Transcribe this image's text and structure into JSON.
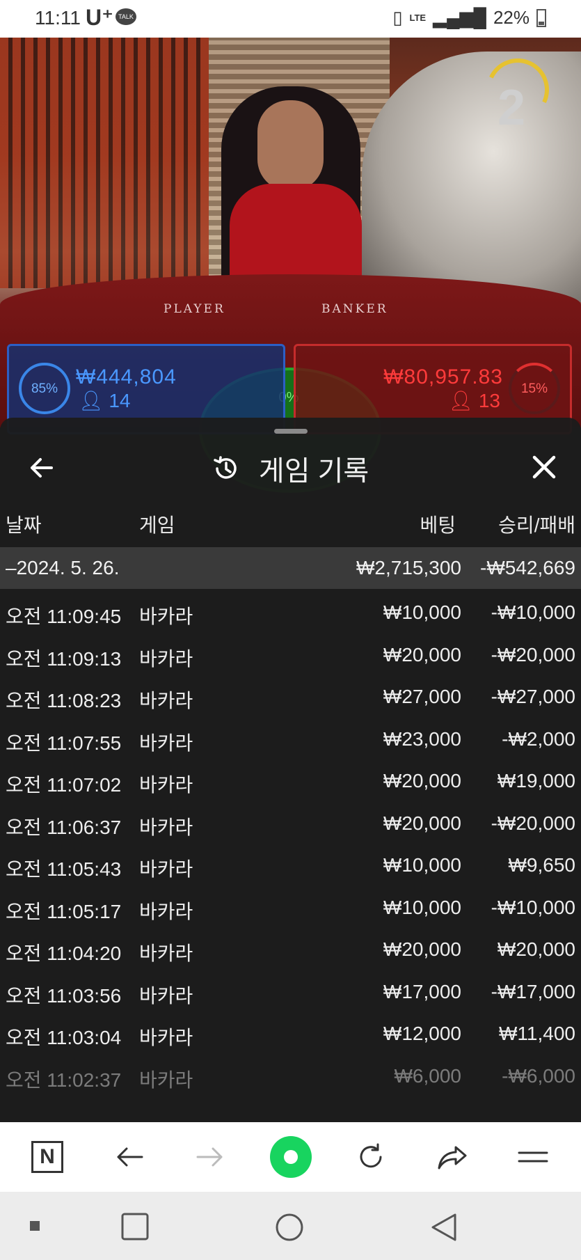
{
  "status_bar": {
    "time": "11:11",
    "carrier": "U⁺",
    "talk_badge": "TALK",
    "network": "LTE",
    "battery": "22%"
  },
  "video": {
    "timer_value": "2",
    "table_player_text": "PLAYER",
    "table_banker_text": "BANKER"
  },
  "bets": {
    "player": {
      "percent": "85%",
      "amount": "₩444,804",
      "count": "14"
    },
    "banker": {
      "percent": "15%",
      "amount": "₩80,957.83",
      "count": "13"
    },
    "tie": {
      "percent": "0%"
    }
  },
  "sheet": {
    "title": "게임 기록",
    "columns": {
      "date": "날짜",
      "game": "게임",
      "bet": "베팅",
      "result": "승리/패배"
    },
    "summary": {
      "date": "–2024. 5. 26.",
      "bet": "₩2,715,300",
      "result": "-₩542,669"
    },
    "rows": [
      {
        "time": "오전 11:09:45",
        "game": "바카라",
        "bet": "₩10,000",
        "result": "-₩10,000"
      },
      {
        "time": "오전 11:09:13",
        "game": "바카라",
        "bet": "₩20,000",
        "result": "-₩20,000"
      },
      {
        "time": "오전 11:08:23",
        "game": "바카라",
        "bet": "₩27,000",
        "result": "-₩27,000"
      },
      {
        "time": "오전 11:07:55",
        "game": "바카라",
        "bet": "₩23,000",
        "result": "-₩2,000"
      },
      {
        "time": "오전 11:07:02",
        "game": "바카라",
        "bet": "₩20,000",
        "result": "₩19,000"
      },
      {
        "time": "오전 11:06:37",
        "game": "바카라",
        "bet": "₩20,000",
        "result": "-₩20,000"
      },
      {
        "time": "오전 11:05:43",
        "game": "바카라",
        "bet": "₩10,000",
        "result": "₩9,650"
      },
      {
        "time": "오전 11:05:17",
        "game": "바카라",
        "bet": "₩10,000",
        "result": "-₩10,000"
      },
      {
        "time": "오전 11:04:20",
        "game": "바카라",
        "bet": "₩20,000",
        "result": "₩20,000"
      },
      {
        "time": "오전 11:03:56",
        "game": "바카라",
        "bet": "₩17,000",
        "result": "-₩17,000"
      },
      {
        "time": "오전 11:03:04",
        "game": "바카라",
        "bet": "₩12,000",
        "result": "₩11,400"
      },
      {
        "time": "오전 11:02:37",
        "game": "바카라",
        "bet": "₩6,000",
        "result": "-₩6,000"
      }
    ]
  },
  "browser_bar": {
    "home_label": "N",
    "icons": [
      "naver-home-icon",
      "back-arrow-icon",
      "forward-arrow-icon",
      "green-dot-icon",
      "refresh-icon",
      "share-icon",
      "menu-icon"
    ]
  },
  "colors": {
    "player_blue": "#2c5fc5",
    "banker_red": "#c52c2c",
    "tie_green": "#26a82e",
    "summary_row_bg": "#3a3a3a",
    "browser_green": "#18d45f"
  }
}
